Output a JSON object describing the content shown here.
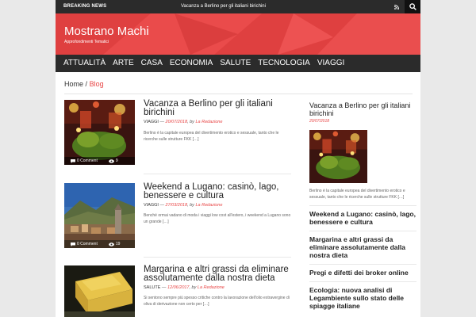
{
  "topbar": {
    "breaking_label": "BREAKING NEWS",
    "breaking_text": "Vacanza a Berlino per gli italiani birichini"
  },
  "header": {
    "site_title": "Mostrano Machi",
    "site_description": "Approfondimenti Tematici"
  },
  "nav": {
    "items": [
      "ATTUALITÀ",
      "ARTE",
      "CASA",
      "ECONOMIA",
      "SALUTE",
      "TECNOLOGIA",
      "VIAGGI"
    ]
  },
  "breadcrumb": {
    "home": "Home",
    "separator": "/",
    "current": "Blog"
  },
  "posts": [
    {
      "title": "Vacanza a Berlino per gli italiani birichini",
      "category": "VIAGGI",
      "dash": " — ",
      "date": "20/07/2018",
      "by": ", by ",
      "author": "La Redazione",
      "excerpt": "Berlino è la capitale europea del divertimento erotico e sessuale, tanto che le ricerche sulle strutture FKK […]",
      "comments": "0 Comment",
      "views": "9",
      "thumb_icon": "nightclub-photo"
    },
    {
      "title": "Weekend a Lugano: casinò, lago, benessere e cultura",
      "category": "VIAGGI",
      "dash": " — ",
      "date": "27/03/2018",
      "by": ", by ",
      "author": "La Redazione",
      "excerpt": "Benché ormai vadano di moda i viaggi low cost all'estero, i weekend a Lugano sono un grande […]",
      "comments": "0 Comment",
      "views": "19",
      "thumb_icon": "lake-town-photo"
    },
    {
      "title": "Margarina e altri grassi da eliminare assolutamente dalla nostra dieta",
      "category": "SALUTE",
      "dash": " — ",
      "date": "12/06/2017",
      "by": ", by ",
      "author": "La Redazione",
      "excerpt": "Si sentono sempre più spesso critiche contro la lavorazione dell'olio extravergine di oliva di derivazione non certo per […]",
      "thumb_icon": "butter-photo"
    }
  ],
  "sidebar": {
    "featured": {
      "title": "Vacanza a Berlino per gli italiani birichini",
      "date": "20/07/2018",
      "excerpt": "Berlino è la capitale europea del divertimento erotico e sessuale, tanto che le ricerche sulle strutture FKK […]"
    },
    "items": [
      "Weekend a Lugano: casinò, lago, benessere e cultura",
      "Margarina e altri grassi da eliminare assolutamente dalla nostra dieta",
      "Pregi e difetti dei broker online",
      "Ecologia: nuova analisi di Legambiente sullo stato delle spiagge italiane"
    ]
  },
  "colors": {
    "accent": "#e84545",
    "dark": "#2b2b2b"
  },
  "icons": [
    "rss-icon",
    "search-icon",
    "comment-icon",
    "eye-icon"
  ]
}
